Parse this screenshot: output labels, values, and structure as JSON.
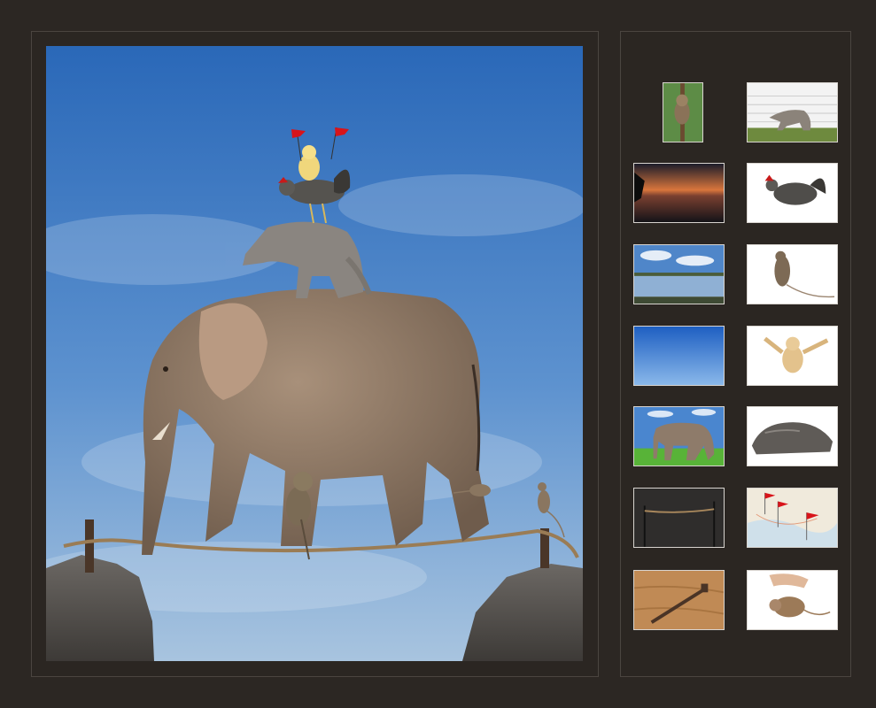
{
  "composite": {
    "subject": "elephant-tightrope-scene"
  },
  "thumbnails": [
    {
      "name": "thumb-tarsier",
      "icon": "tarsier-photo"
    },
    {
      "name": "thumb-kangaroo",
      "icon": "kangaroo-photo"
    },
    {
      "name": "thumb-sunset-lake",
      "icon": "sunset-photo"
    },
    {
      "name": "thumb-rooster",
      "icon": "rooster-photo"
    },
    {
      "name": "thumb-lake-clouds",
      "icon": "lake-photo"
    },
    {
      "name": "thumb-mouse",
      "icon": "mouse-photo"
    },
    {
      "name": "thumb-blue-sky",
      "icon": "sky-photo"
    },
    {
      "name": "thumb-chick",
      "icon": "chick-photo"
    },
    {
      "name": "thumb-elephant",
      "icon": "elephant-photo"
    },
    {
      "name": "thumb-rock",
      "icon": "rock-photo"
    },
    {
      "name": "thumb-rope-studio",
      "icon": "rope-photo"
    },
    {
      "name": "thumb-map-flags",
      "icon": "flags-photo"
    },
    {
      "name": "thumb-nail-wood",
      "icon": "nail-photo"
    },
    {
      "name": "thumb-hand-mouse",
      "icon": "hand-mouse-photo"
    }
  ],
  "colors": {
    "background": "#2c2723",
    "panel_border": "#4b4540",
    "sky_top": "#2e6fc0",
    "sky_bottom": "#a9c6e0",
    "flag_red": "#d8141a"
  }
}
